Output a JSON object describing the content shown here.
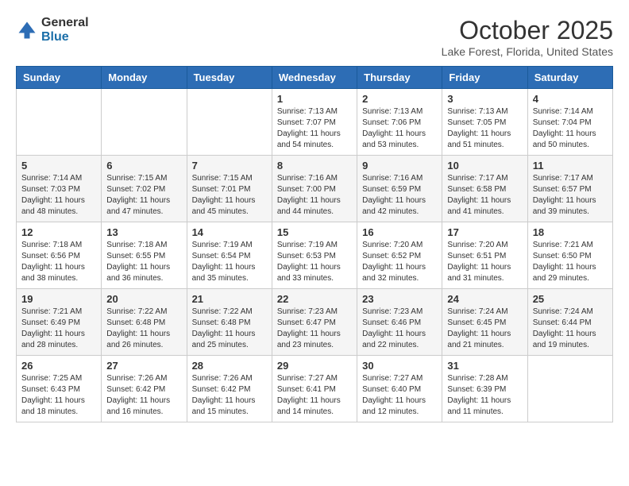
{
  "header": {
    "logo": {
      "general": "General",
      "blue": "Blue"
    },
    "title": "October 2025",
    "subtitle": "Lake Forest, Florida, United States"
  },
  "weekdays": [
    "Sunday",
    "Monday",
    "Tuesday",
    "Wednesday",
    "Thursday",
    "Friday",
    "Saturday"
  ],
  "weeks": [
    [
      {
        "day": "",
        "info": ""
      },
      {
        "day": "",
        "info": ""
      },
      {
        "day": "",
        "info": ""
      },
      {
        "day": "1",
        "info": "Sunrise: 7:13 AM\nSunset: 7:07 PM\nDaylight: 11 hours and 54 minutes."
      },
      {
        "day": "2",
        "info": "Sunrise: 7:13 AM\nSunset: 7:06 PM\nDaylight: 11 hours and 53 minutes."
      },
      {
        "day": "3",
        "info": "Sunrise: 7:13 AM\nSunset: 7:05 PM\nDaylight: 11 hours and 51 minutes."
      },
      {
        "day": "4",
        "info": "Sunrise: 7:14 AM\nSunset: 7:04 PM\nDaylight: 11 hours and 50 minutes."
      }
    ],
    [
      {
        "day": "5",
        "info": "Sunrise: 7:14 AM\nSunset: 7:03 PM\nDaylight: 11 hours and 48 minutes."
      },
      {
        "day": "6",
        "info": "Sunrise: 7:15 AM\nSunset: 7:02 PM\nDaylight: 11 hours and 47 minutes."
      },
      {
        "day": "7",
        "info": "Sunrise: 7:15 AM\nSunset: 7:01 PM\nDaylight: 11 hours and 45 minutes."
      },
      {
        "day": "8",
        "info": "Sunrise: 7:16 AM\nSunset: 7:00 PM\nDaylight: 11 hours and 44 minutes."
      },
      {
        "day": "9",
        "info": "Sunrise: 7:16 AM\nSunset: 6:59 PM\nDaylight: 11 hours and 42 minutes."
      },
      {
        "day": "10",
        "info": "Sunrise: 7:17 AM\nSunset: 6:58 PM\nDaylight: 11 hours and 41 minutes."
      },
      {
        "day": "11",
        "info": "Sunrise: 7:17 AM\nSunset: 6:57 PM\nDaylight: 11 hours and 39 minutes."
      }
    ],
    [
      {
        "day": "12",
        "info": "Sunrise: 7:18 AM\nSunset: 6:56 PM\nDaylight: 11 hours and 38 minutes."
      },
      {
        "day": "13",
        "info": "Sunrise: 7:18 AM\nSunset: 6:55 PM\nDaylight: 11 hours and 36 minutes."
      },
      {
        "day": "14",
        "info": "Sunrise: 7:19 AM\nSunset: 6:54 PM\nDaylight: 11 hours and 35 minutes."
      },
      {
        "day": "15",
        "info": "Sunrise: 7:19 AM\nSunset: 6:53 PM\nDaylight: 11 hours and 33 minutes."
      },
      {
        "day": "16",
        "info": "Sunrise: 7:20 AM\nSunset: 6:52 PM\nDaylight: 11 hours and 32 minutes."
      },
      {
        "day": "17",
        "info": "Sunrise: 7:20 AM\nSunset: 6:51 PM\nDaylight: 11 hours and 31 minutes."
      },
      {
        "day": "18",
        "info": "Sunrise: 7:21 AM\nSunset: 6:50 PM\nDaylight: 11 hours and 29 minutes."
      }
    ],
    [
      {
        "day": "19",
        "info": "Sunrise: 7:21 AM\nSunset: 6:49 PM\nDaylight: 11 hours and 28 minutes."
      },
      {
        "day": "20",
        "info": "Sunrise: 7:22 AM\nSunset: 6:48 PM\nDaylight: 11 hours and 26 minutes."
      },
      {
        "day": "21",
        "info": "Sunrise: 7:22 AM\nSunset: 6:48 PM\nDaylight: 11 hours and 25 minutes."
      },
      {
        "day": "22",
        "info": "Sunrise: 7:23 AM\nSunset: 6:47 PM\nDaylight: 11 hours and 23 minutes."
      },
      {
        "day": "23",
        "info": "Sunrise: 7:23 AM\nSunset: 6:46 PM\nDaylight: 11 hours and 22 minutes."
      },
      {
        "day": "24",
        "info": "Sunrise: 7:24 AM\nSunset: 6:45 PM\nDaylight: 11 hours and 21 minutes."
      },
      {
        "day": "25",
        "info": "Sunrise: 7:24 AM\nSunset: 6:44 PM\nDaylight: 11 hours and 19 minutes."
      }
    ],
    [
      {
        "day": "26",
        "info": "Sunrise: 7:25 AM\nSunset: 6:43 PM\nDaylight: 11 hours and 18 minutes."
      },
      {
        "day": "27",
        "info": "Sunrise: 7:26 AM\nSunset: 6:42 PM\nDaylight: 11 hours and 16 minutes."
      },
      {
        "day": "28",
        "info": "Sunrise: 7:26 AM\nSunset: 6:42 PM\nDaylight: 11 hours and 15 minutes."
      },
      {
        "day": "29",
        "info": "Sunrise: 7:27 AM\nSunset: 6:41 PM\nDaylight: 11 hours and 14 minutes."
      },
      {
        "day": "30",
        "info": "Sunrise: 7:27 AM\nSunset: 6:40 PM\nDaylight: 11 hours and 12 minutes."
      },
      {
        "day": "31",
        "info": "Sunrise: 7:28 AM\nSunset: 6:39 PM\nDaylight: 11 hours and 11 minutes."
      },
      {
        "day": "",
        "info": ""
      }
    ]
  ]
}
